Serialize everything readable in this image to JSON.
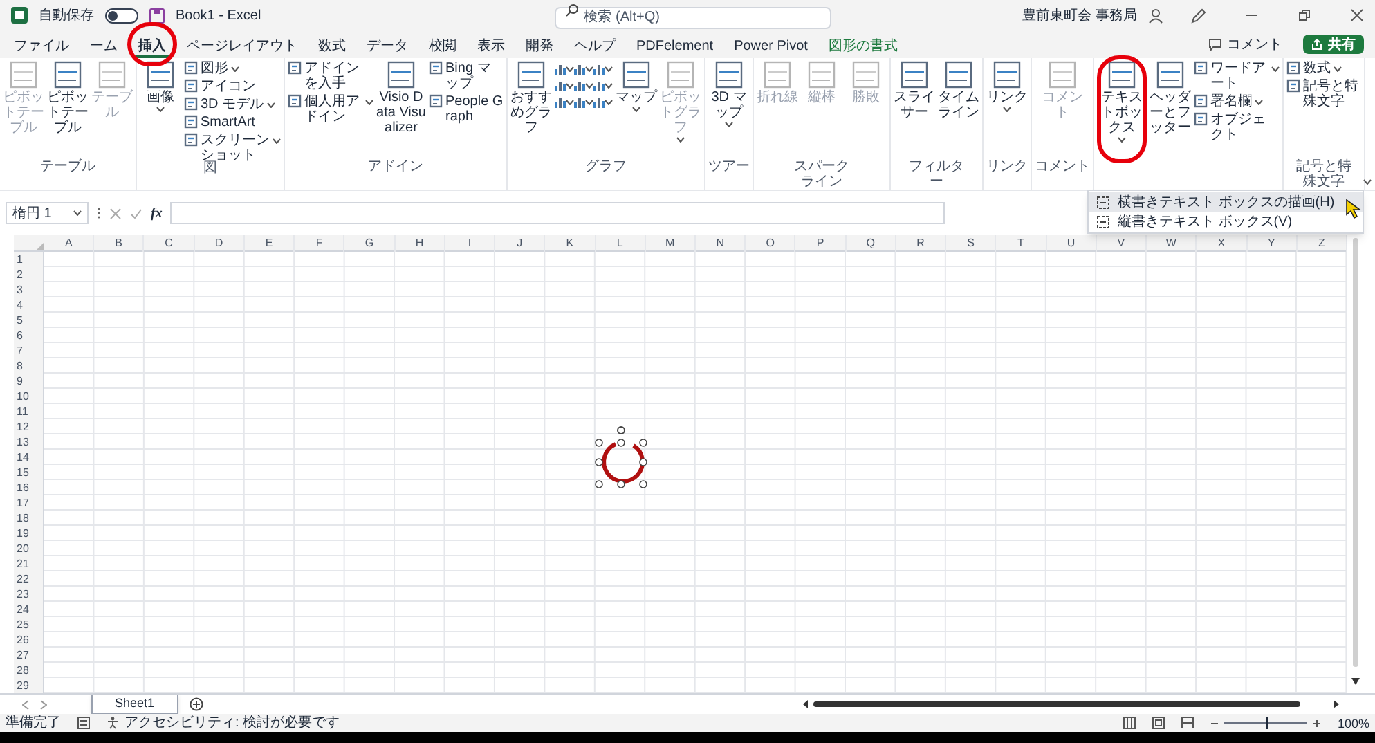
{
  "title_bar": {
    "autosave_label": "自動保存",
    "autosave_on": false,
    "file_title": "Book1 - Excel",
    "search_placeholder": "検索 (Alt+Q)",
    "user": "豊前東町会 事務局"
  },
  "tabs": [
    {
      "label": "ファイル",
      "selected": false,
      "highlighted": false,
      "kind": "normal"
    },
    {
      "label": "ーム",
      "selected": false,
      "highlighted": false,
      "kind": "normal"
    },
    {
      "label": "挿入",
      "selected": true,
      "highlighted": true,
      "kind": "normal"
    },
    {
      "label": "ページレイアウト",
      "selected": false,
      "highlighted": false,
      "kind": "normal"
    },
    {
      "label": "数式",
      "selected": false,
      "highlighted": false,
      "kind": "normal"
    },
    {
      "label": "データ",
      "selected": false,
      "highlighted": false,
      "kind": "normal"
    },
    {
      "label": "校閲",
      "selected": false,
      "highlighted": false,
      "kind": "normal"
    },
    {
      "label": "表示",
      "selected": false,
      "highlighted": false,
      "kind": "normal"
    },
    {
      "label": "開発",
      "selected": false,
      "highlighted": false,
      "kind": "normal"
    },
    {
      "label": "ヘルプ",
      "selected": false,
      "highlighted": false,
      "kind": "normal"
    },
    {
      "label": "PDFelement",
      "selected": false,
      "highlighted": false,
      "kind": "normal"
    },
    {
      "label": "Power Pivot",
      "selected": false,
      "highlighted": false,
      "kind": "normal"
    },
    {
      "label": "図形の書式",
      "selected": false,
      "highlighted": false,
      "kind": "contextual"
    }
  ],
  "ribbon_actions": {
    "comment": "コメント",
    "share": "共有"
  },
  "ribbon": {
    "groups": [
      {
        "label": "テーブル",
        "items": [
          {
            "kind": "large",
            "label": "ピボットテーブル",
            "disabled": true,
            "dropdown": false,
            "highlighted": false
          },
          {
            "kind": "large",
            "label": "ピボットテーブル",
            "disabled": false,
            "dropdown": false,
            "highlighted": false
          },
          {
            "kind": "large",
            "label": "テーブル",
            "disabled": true,
            "dropdown": false,
            "highlighted": false
          }
        ]
      },
      {
        "label": "図",
        "items": [
          {
            "kind": "large",
            "label": "画像",
            "disabled": false,
            "dropdown": true,
            "highlighted": false
          },
          {
            "kind": "small",
            "label": "図形",
            "disabled": false,
            "dropdown": true,
            "highlighted": false
          },
          {
            "kind": "small",
            "label": "アイコン",
            "disabled": false,
            "dropdown": false,
            "highlighted": false
          },
          {
            "kind": "small",
            "label": "3D モデル",
            "disabled": false,
            "dropdown": true,
            "highlighted": false
          },
          {
            "kind": "small",
            "label": "SmartArt",
            "disabled": false,
            "dropdown": false,
            "highlighted": false
          },
          {
            "kind": "small",
            "label": "スクリーンショット",
            "disabled": false,
            "dropdown": true,
            "highlighted": false
          }
        ]
      },
      {
        "label": "アドイン",
        "items": [
          {
            "kind": "small",
            "label": "アドインを入手",
            "disabled": false,
            "dropdown": false,
            "highlighted": false
          },
          {
            "kind": "small",
            "label": "個人用アドイン",
            "disabled": false,
            "dropdown": true,
            "highlighted": false
          },
          {
            "kind": "large",
            "label": "Visio Data Visualizer",
            "disabled": false,
            "dropdown": false,
            "highlighted": false
          },
          {
            "kind": "small",
            "label": "Bing マップ",
            "disabled": false,
            "dropdown": false,
            "highlighted": false
          },
          {
            "kind": "small",
            "label": "People Graph",
            "disabled": false,
            "dropdown": false,
            "highlighted": false
          }
        ]
      },
      {
        "label": "グラフ",
        "items": [
          {
            "kind": "large",
            "label": "おすすめグラフ",
            "disabled": false,
            "dropdown": false,
            "highlighted": false
          },
          {
            "kind": "chart_grid"
          },
          {
            "kind": "large",
            "label": "マップ",
            "disabled": false,
            "dropdown": true,
            "highlighted": false
          },
          {
            "kind": "large",
            "label": "ピボットグラフ",
            "disabled": true,
            "dropdown": true,
            "highlighted": false
          }
        ]
      },
      {
        "label": "ツアー",
        "items": [
          {
            "kind": "large",
            "label": "3D マップ",
            "disabled": false,
            "dropdown": true,
            "highlighted": false
          }
        ]
      },
      {
        "label": "スパークライン",
        "items": [
          {
            "kind": "large",
            "label": "折れ線",
            "disabled": true,
            "dropdown": false,
            "highlighted": false
          },
          {
            "kind": "large",
            "label": "縦棒",
            "disabled": true,
            "dropdown": false,
            "highlighted": false
          },
          {
            "kind": "large",
            "label": "勝敗",
            "disabled": true,
            "dropdown": false,
            "highlighted": false
          }
        ]
      },
      {
        "label": "フィルター",
        "items": [
          {
            "kind": "large",
            "label": "スライサー",
            "disabled": false,
            "dropdown": false,
            "highlighted": false
          },
          {
            "kind": "large",
            "label": "タイムライン",
            "disabled": false,
            "dropdown": false,
            "highlighted": false
          }
        ]
      },
      {
        "label": "リンク",
        "items": [
          {
            "kind": "large",
            "label": "リンク",
            "disabled": false,
            "dropdown": true,
            "highlighted": false
          }
        ]
      },
      {
        "label": "コメント",
        "items": [
          {
            "kind": "large",
            "label": "コメント",
            "disabled": true,
            "dropdown": false,
            "highlighted": false
          }
        ]
      },
      {
        "items": [
          {
            "kind": "large",
            "label": "テキストボックス",
            "disabled": false,
            "dropdown": true,
            "highlighted": true,
            "menu": [
              {
                "label": "横書きテキスト ボックスの描画(H)",
                "selected": true
              },
              {
                "label": "縦書きテキスト ボックス(V)",
                "selected": false
              }
            ]
          },
          {
            "kind": "large",
            "label": "ヘッダーとフッター",
            "disabled": false,
            "dropdown": false,
            "highlighted": false
          },
          {
            "kind": "small",
            "label": "ワードアート",
            "disabled": false,
            "dropdown": true,
            "highlighted": false
          },
          {
            "kind": "small",
            "label": "署名欄",
            "disabled": false,
            "dropdown": true,
            "highlighted": false
          },
          {
            "kind": "small",
            "label": "オブジェクト",
            "disabled": false,
            "dropdown": false,
            "highlighted": false
          }
        ]
      },
      {
        "label": "記号と特殊文字",
        "items": [
          {
            "kind": "small",
            "label": "数式",
            "disabled": false,
            "dropdown": true,
            "highlighted": false
          },
          {
            "kind": "small",
            "label": "記号と特殊文字",
            "disabled": false,
            "dropdown": false,
            "highlighted": false
          }
        ]
      }
    ]
  },
  "formula_bar": {
    "name_box": "楕円 1",
    "fx": "fx"
  },
  "sheet": {
    "columns": [
      "A",
      "B",
      "C",
      "D",
      "E",
      "F",
      "G",
      "H",
      "I",
      "J",
      "K",
      "L",
      "M",
      "N",
      "O",
      "P",
      "Q",
      "R",
      "S",
      "T",
      "U",
      "V",
      "W",
      "X",
      "Y",
      "Z"
    ],
    "rows": [
      "1",
      "2",
      "3",
      "4",
      "5",
      "6",
      "7",
      "8",
      "9",
      "10",
      "11",
      "12",
      "13",
      "14",
      "15",
      "16",
      "17",
      "18",
      "19",
      "20",
      "21",
      "22",
      "23",
      "24",
      "25",
      "26",
      "27",
      "28",
      "29"
    ],
    "shape": {
      "selected": true
    }
  },
  "sheet_tabs": [
    {
      "label": "Sheet1",
      "selected": true
    }
  ],
  "status_bar": {
    "ready": "準備完了",
    "accessibility": "アクセシビリティ: 検討が必要です",
    "zoom": {
      "level": 0.5,
      "reading": "100%"
    }
  }
}
